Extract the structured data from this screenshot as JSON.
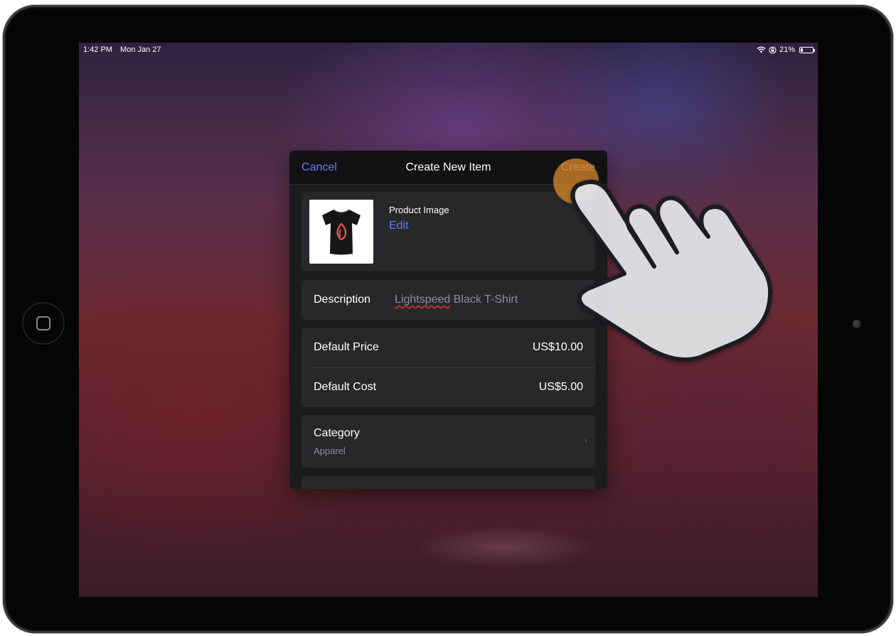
{
  "status_bar": {
    "time": "1:42 PM",
    "date": "Mon Jan 27",
    "battery_percent": "21%",
    "battery_level": 0.21,
    "icons": [
      "wifi-icon",
      "screen-lock-rotation-icon",
      "battery-icon"
    ]
  },
  "modal": {
    "cancel_label": "Cancel",
    "title": "Create New Item",
    "create_label": "Create",
    "product_image": {
      "label": "Product Image",
      "edit_label": "Edit",
      "thumbnail": "black-tshirt-with-logo"
    },
    "description": {
      "label": "Description",
      "value_misspelled": "Lightspeed",
      "value_rest": " Black T-Shirt"
    },
    "pricing": {
      "price_label": "Default Price",
      "price_value": "US$10.00",
      "cost_label": "Default Cost",
      "cost_value": "US$5.00"
    },
    "category": {
      "label": "Category",
      "value": "Apparel",
      "chevron": "›"
    }
  },
  "colors": {
    "accent_blue": "#5e7ef6",
    "disabled_gray": "#8e8e93",
    "tap_highlight": "#d9892a"
  },
  "overlay": {
    "pointer": "tap-hand-icon"
  }
}
